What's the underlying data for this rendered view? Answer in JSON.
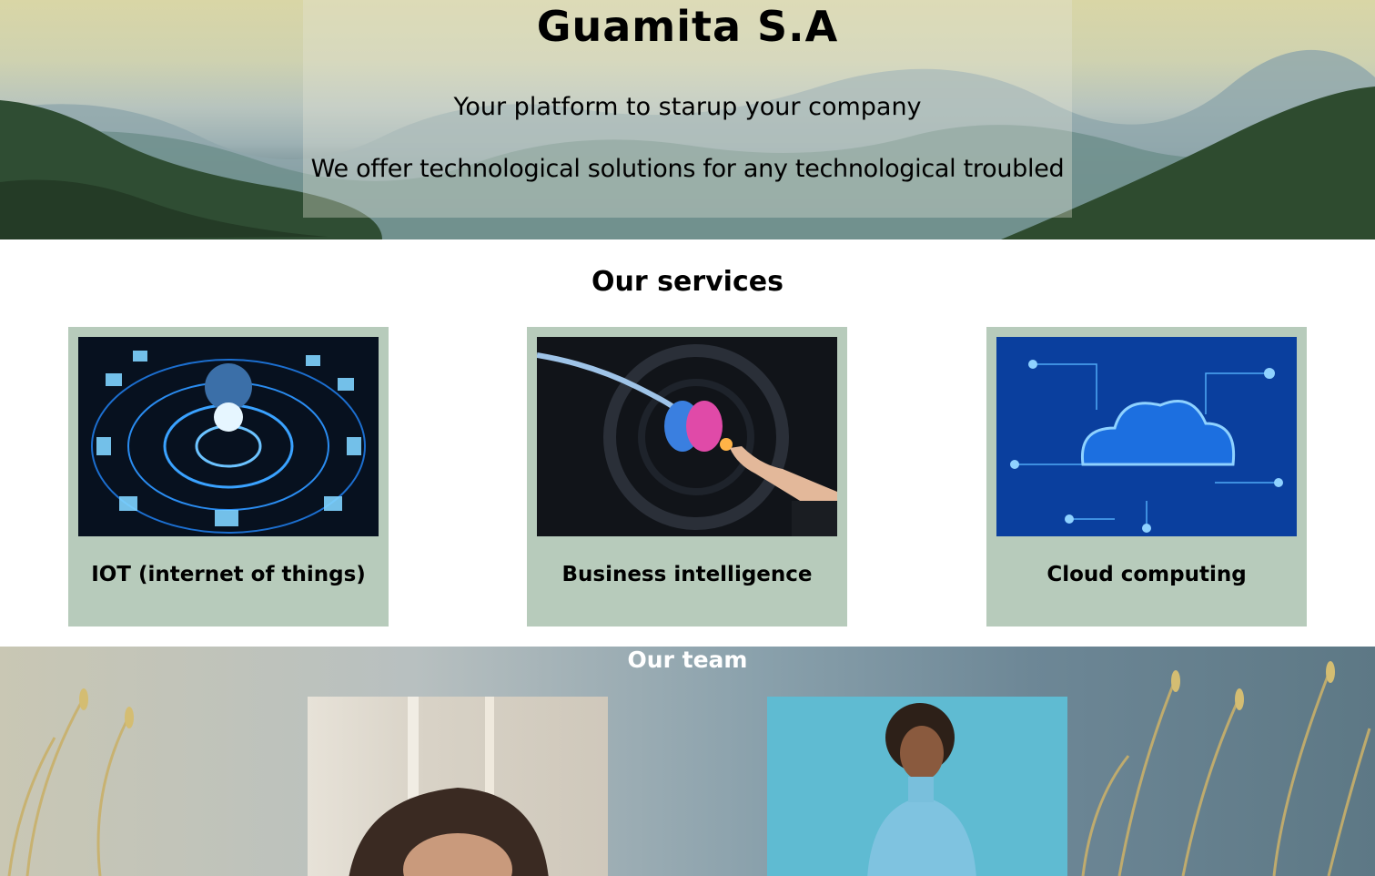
{
  "hero": {
    "title": "Guamita S.A",
    "tagline": "Your platform to starup your company",
    "description": "We offer technological solutions for any technological troubled"
  },
  "services": {
    "title": "Our services",
    "items": [
      {
        "label": "IOT (internet of things)",
        "image": "iot-network-globe"
      },
      {
        "label": "Business intelligence",
        "image": "robot-hand-brain"
      },
      {
        "label": "Cloud computing",
        "image": "cloud-circuit"
      }
    ]
  },
  "team": {
    "title": "Our team",
    "members": [
      {
        "image": "woman-curly-hair-portrait"
      },
      {
        "image": "woman-blue-sweater-portrait"
      }
    ]
  },
  "colors": {
    "card_background": "#b7cbbb",
    "team_title": "#ffffff",
    "text": "#000000"
  }
}
